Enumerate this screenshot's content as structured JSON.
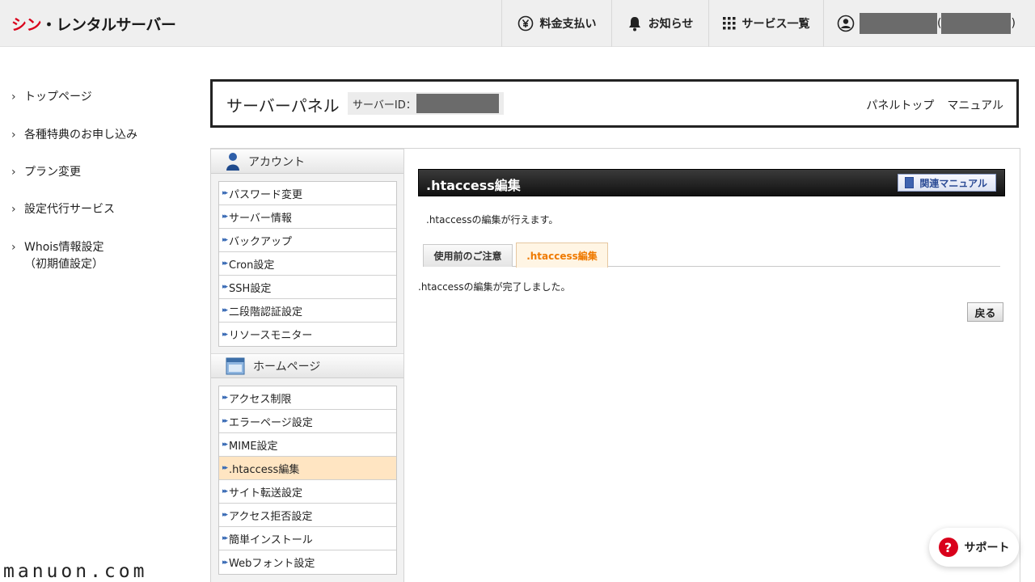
{
  "header": {
    "logo_red": "シン",
    "logo_dark": "・レンタルサーバー",
    "nav": [
      {
        "label": "料金支払い",
        "icon": "yen-icon"
      },
      {
        "label": "お知らせ",
        "icon": "bell-icon"
      },
      {
        "label": "サービス一覧",
        "icon": "grid-icon"
      }
    ],
    "user_paren_open": "(",
    "user_paren_close": ")"
  },
  "sidenav": {
    "items": [
      {
        "label": "トップページ"
      },
      {
        "label": "各種特典のお申し込み"
      },
      {
        "label": "プラン変更"
      },
      {
        "label": "設定代行サービス"
      },
      {
        "label": "Whois情報設定",
        "sub": "（初期値設定）"
      }
    ]
  },
  "panel": {
    "title": "サーバーパネル",
    "server_id_label": "サーバーID：",
    "links": [
      "パネルトップ",
      "マニュアル"
    ]
  },
  "menu": {
    "account": {
      "title": "アカウント",
      "items": [
        "パスワード変更",
        "サーバー情報",
        "バックアップ",
        "Cron設定",
        "SSH設定",
        "二段階認証設定",
        "リソースモニター"
      ]
    },
    "homepage": {
      "title": "ホームページ",
      "items": [
        "アクセス制限",
        "エラーページ設定",
        "MIME設定",
        ".htaccess編集",
        "サイト転送設定",
        "アクセス拒否設定",
        "簡単インストール",
        "Webフォント設定"
      ],
      "active_index": 3
    }
  },
  "main": {
    "title": ".htaccess編集",
    "manual_button": "関連マニュアル",
    "description": ".htaccessの編集が行えます。",
    "tabs": [
      "使用前のご注意",
      ".htaccess編集"
    ],
    "message": ".htaccessの編集が完了しました。",
    "back_button": "戻る"
  },
  "support": {
    "label": "サポート"
  },
  "watermark": "manuon.com",
  "colors": {
    "brand_red": "#d9001b",
    "active_tab": "#ef7a00",
    "active_menu_bg": "#ffe5c2"
  }
}
